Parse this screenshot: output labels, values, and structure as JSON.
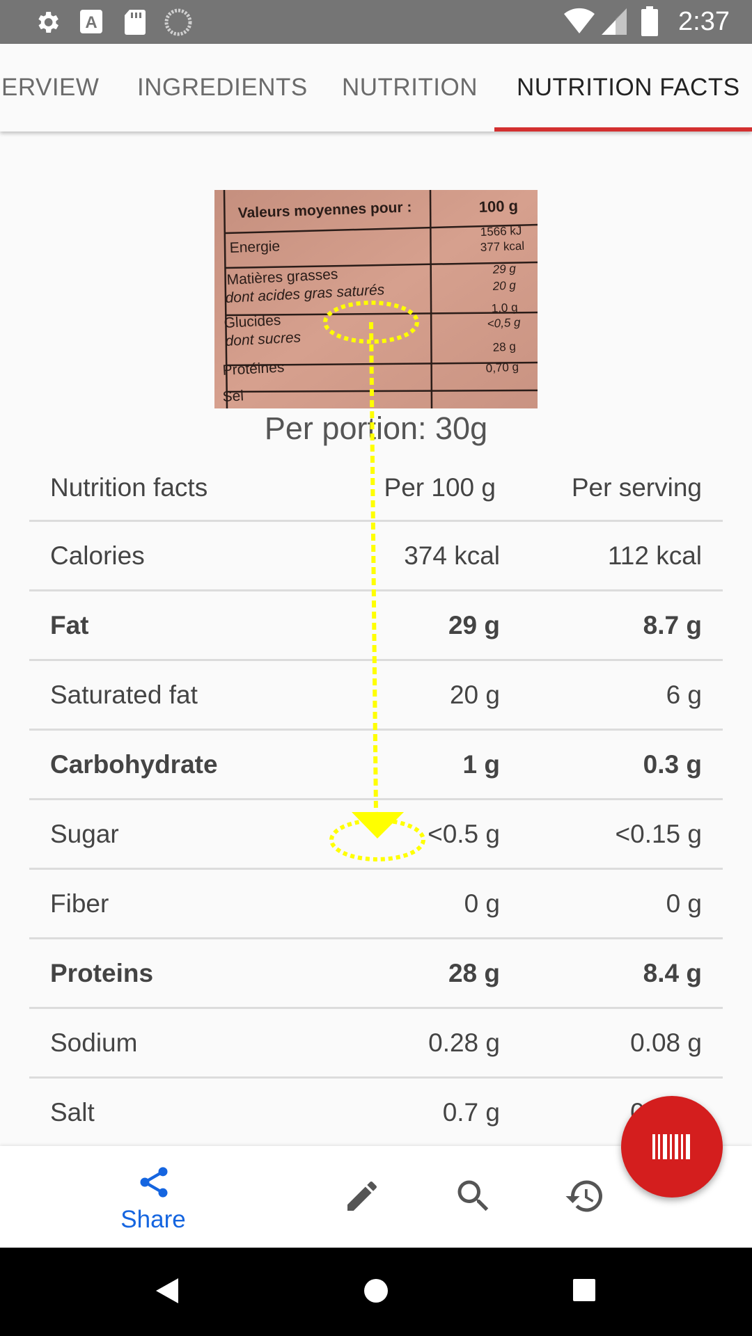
{
  "status_bar": {
    "time": "2:37"
  },
  "tabs": [
    {
      "label": "ERVIEW"
    },
    {
      "label": "INGREDIENTS"
    },
    {
      "label": "NUTRITION"
    },
    {
      "label": "NUTRITION FACTS",
      "active": true
    }
  ],
  "label_photo": {
    "header": "Valeurs moyennes pour :",
    "header_value": "100 g",
    "rows": [
      {
        "label": "Energie",
        "value": "1566 kJ",
        "value2": "377 kcal"
      },
      {
        "label": "Matières grasses",
        "value": "29 g"
      },
      {
        "label": "dont acides gras saturés",
        "value": "20 g"
      },
      {
        "label": "Glucides",
        "value": "1,0 g"
      },
      {
        "label": "dont sucres",
        "value": "<0,5 g"
      },
      {
        "label": "Protéines",
        "value": "28 g"
      },
      {
        "label": "Sel",
        "value": "0,70 g"
      }
    ]
  },
  "portion_text": "Per portion: 30g",
  "nutrition_table": {
    "header": {
      "name": "Nutrition facts",
      "per100": "Per 100 g",
      "serving": "Per serving"
    },
    "rows": [
      {
        "name": "Calories",
        "per100": "374 kcal",
        "serving": "112 kcal",
        "bold": false
      },
      {
        "name": "Fat",
        "per100": "29 g",
        "serving": "8.7 g",
        "bold": true
      },
      {
        "name": "Saturated fat",
        "per100": "20 g",
        "serving": "6 g",
        "bold": false
      },
      {
        "name": "Carbohydrate",
        "per100": "1 g",
        "serving": "0.3 g",
        "bold": true
      },
      {
        "name": "Sugar",
        "per100": "<0.5 g",
        "serving": "<0.15 g",
        "bold": false
      },
      {
        "name": "Fiber",
        "per100": "0 g",
        "serving": "0 g",
        "bold": false
      },
      {
        "name": "Proteins",
        "per100": "28 g",
        "serving": "8.4 g",
        "bold": true
      },
      {
        "name": "Sodium",
        "per100": "0.28 g",
        "serving": "0.08 g",
        "bold": false
      },
      {
        "name": "Salt",
        "per100": "0.7 g",
        "serving": "0.21 g",
        "bold": false
      }
    ]
  },
  "bottom_bar": {
    "share_label": "Share",
    "items": [
      "share-icon",
      "edit-icon",
      "search-icon",
      "history-icon"
    ]
  },
  "fab": {
    "icon": "barcode-icon"
  },
  "colors": {
    "accent": "#d32f2f",
    "share_blue": "#1565e0",
    "annotation": "#ffff00"
  }
}
